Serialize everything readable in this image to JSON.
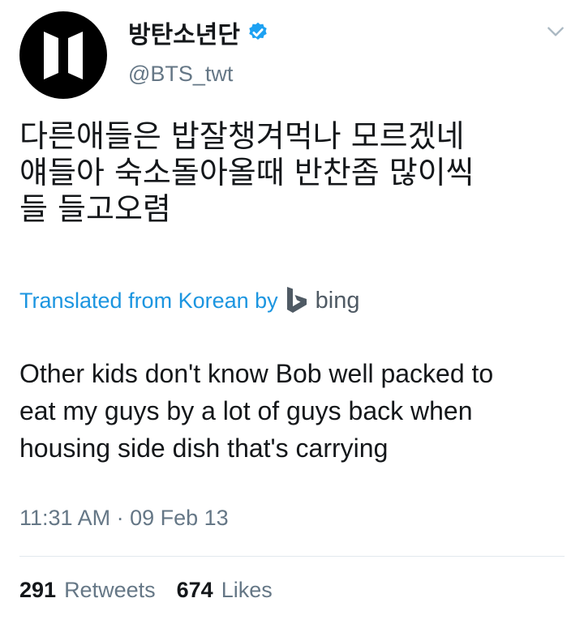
{
  "author": {
    "display_name": "방탄소년단",
    "handle": "@BTS_twt",
    "verified": true
  },
  "tweet": {
    "text": "다른애들은 밥잘챙겨먹나 모르겠네\n얘들아 숙소돌아올때 반찬좀 많이씩\n들 들고오렴",
    "translated_label": "Translated from Korean by",
    "translator": "bing",
    "translation": "Other kids don't know Bob well packed to\neat my guys by a lot of guys back when\nhousing side dish that's carrying",
    "time": "11:31 AM",
    "separator": " · ",
    "date": "09 Feb 13"
  },
  "stats": {
    "retweets_count": "291",
    "retweets_label": "Retweets",
    "likes_count": "674",
    "likes_label": "Likes"
  },
  "icons": {
    "verified": "verified-badge-icon",
    "menu": "chevron-down-icon",
    "translator": "bing-logo-icon"
  },
  "colors": {
    "link": "#1b95e0",
    "verified": "#1da1f2",
    "muted": "#657786",
    "text": "#14171a"
  }
}
